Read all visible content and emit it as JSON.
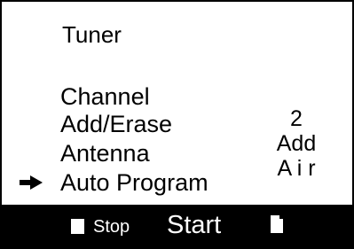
{
  "menu": {
    "title": "Tuner",
    "items": [
      {
        "label": "Channel",
        "value": ""
      },
      {
        "label": "Add/Erase",
        "value": "2"
      },
      {
        "label": "Antenna",
        "value": "Add"
      },
      {
        "label": "Auto Program",
        "value": "A i r"
      }
    ],
    "selected_index": 3,
    "selection_icon": "arrow-right-icon"
  },
  "bottom_bar": {
    "stop_label": "Stop",
    "start_label": "Start",
    "stop_icon": "stop-square-icon",
    "start_icon": "start-square-icon"
  },
  "colors": {
    "background": "#ffffff",
    "foreground": "#000000",
    "bar_background": "#000000",
    "bar_text": "#ffffff"
  }
}
